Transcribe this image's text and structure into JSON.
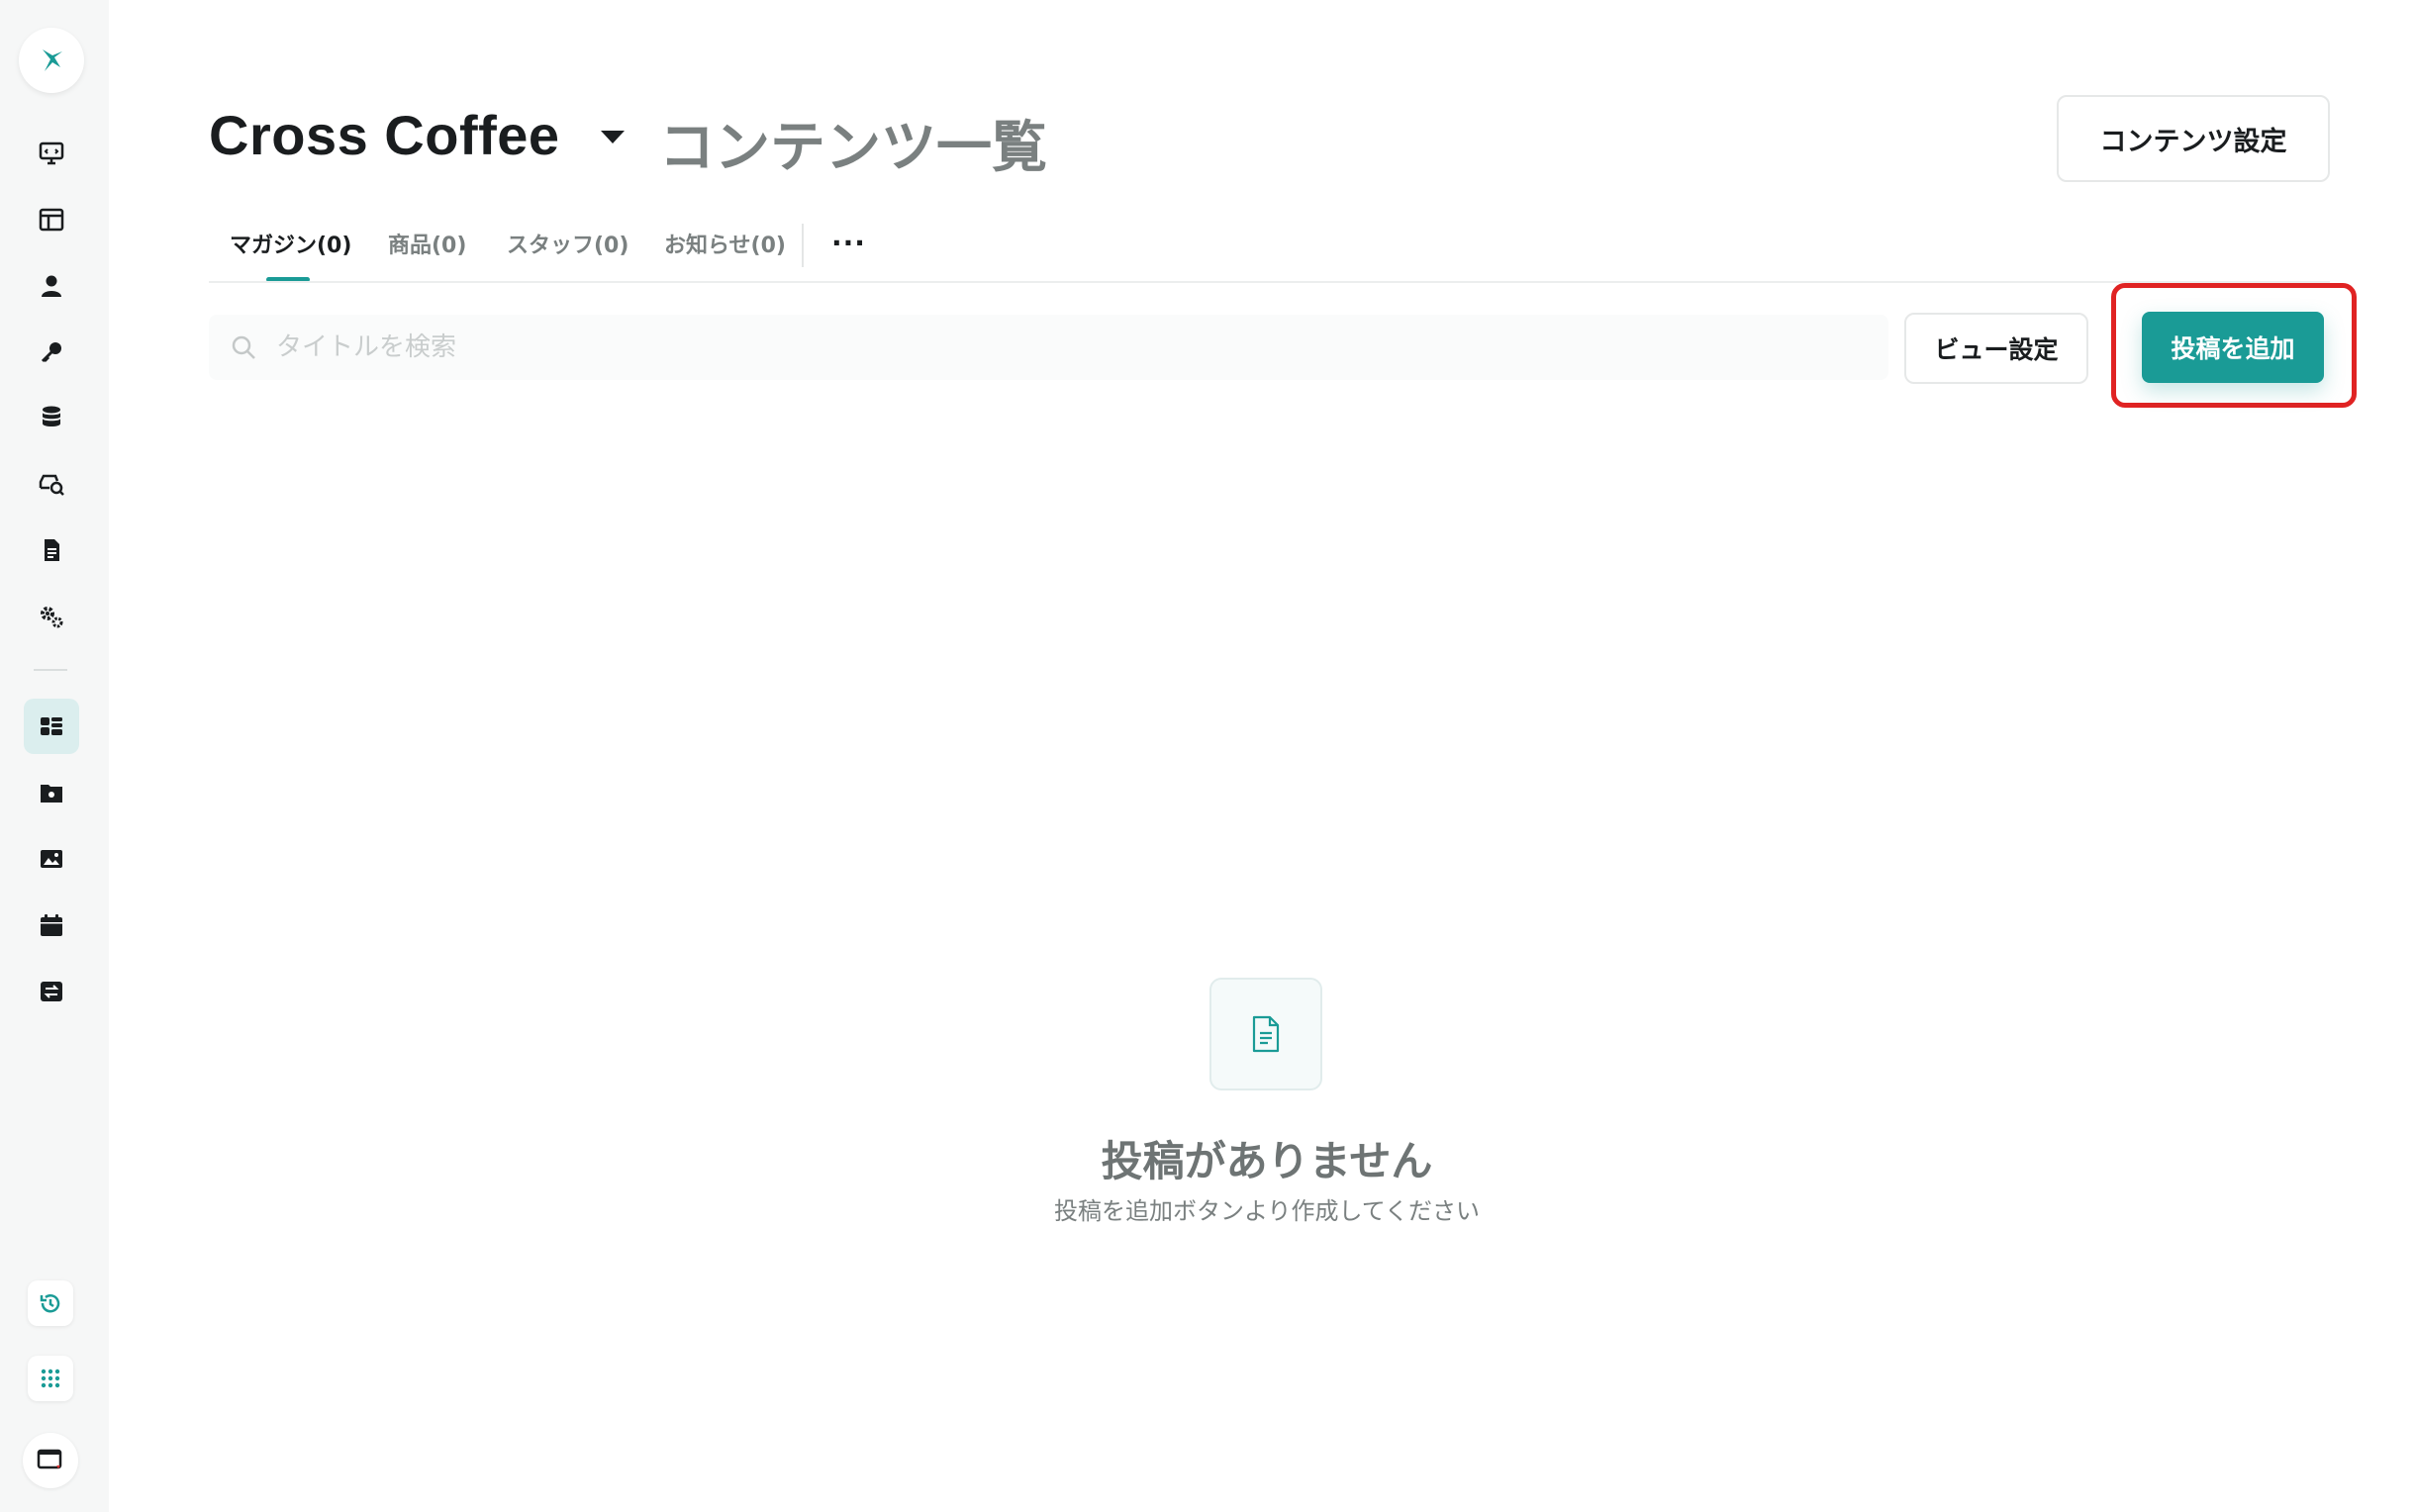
{
  "header": {
    "title": "Cross Coffee",
    "subtitle": "コンテンツ一覧",
    "content_settings_label": "コンテンツ設定"
  },
  "tabs": [
    {
      "label": "マガジン(0)",
      "active": true
    },
    {
      "label": "商品(0)",
      "active": false
    },
    {
      "label": "スタッフ(0)",
      "active": false
    },
    {
      "label": "お知らせ(0)",
      "active": false
    }
  ],
  "tab_more_label": "...",
  "search": {
    "placeholder": "タイトルを検索"
  },
  "actions": {
    "view_settings_label": "ビュー設定",
    "add_post_label": "投稿を追加"
  },
  "empty_state": {
    "title": "投稿がありません",
    "subtitle": "投稿を追加ボタンより作成してください"
  },
  "sidebar": {
    "items": [
      {
        "icon": "monitor-icon"
      },
      {
        "icon": "layout-icon"
      },
      {
        "icon": "user-icon"
      },
      {
        "icon": "key-icon"
      },
      {
        "icon": "database-icon"
      },
      {
        "icon": "search-car-icon"
      },
      {
        "icon": "document-icon"
      },
      {
        "icon": "gears-icon"
      },
      {
        "icon": "dashboard-icon",
        "active": true
      },
      {
        "icon": "folder-gear-icon"
      },
      {
        "icon": "image-icon"
      },
      {
        "icon": "calendar-icon"
      },
      {
        "icon": "swap-icon"
      }
    ],
    "bottom": [
      {
        "icon": "history-icon"
      },
      {
        "icon": "apps-grid-icon"
      },
      {
        "icon": "window-icon"
      }
    ]
  },
  "colors": {
    "accent": "#1a9b96",
    "highlight": "#e02323",
    "sidebar_bg": "#f6f7f7"
  }
}
